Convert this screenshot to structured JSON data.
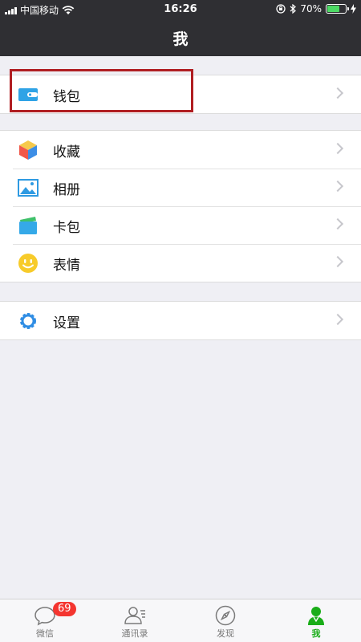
{
  "status_bar": {
    "carrier": "中国移动",
    "time": "16:26",
    "battery": "70%",
    "battery_level": 0.7
  },
  "header": {
    "title": "我"
  },
  "groups": [
    {
      "items": [
        {
          "label": "钱包",
          "icon": "wallet-icon"
        }
      ]
    },
    {
      "items": [
        {
          "label": "收藏",
          "icon": "favorites-cube-icon"
        },
        {
          "label": "相册",
          "icon": "album-picture-icon"
        },
        {
          "label": "卡包",
          "icon": "card-pack-icon"
        },
        {
          "label": "表情",
          "icon": "smiley-face-icon"
        }
      ]
    },
    {
      "items": [
        {
          "label": "设置",
          "icon": "gear-icon"
        }
      ]
    }
  ],
  "tabbar": {
    "tabs": [
      {
        "label": "微信",
        "icon": "chat-bubble-icon",
        "badge": "69"
      },
      {
        "label": "通讯录",
        "icon": "contacts-icon"
      },
      {
        "label": "发现",
        "icon": "compass-icon"
      },
      {
        "label": "我",
        "icon": "me-person-icon",
        "active": true
      }
    ]
  },
  "colors": {
    "accent": "#1aad19",
    "highlight_box": "#b01e22",
    "badge": "#f43530",
    "header_bg": "#2f2f33"
  }
}
